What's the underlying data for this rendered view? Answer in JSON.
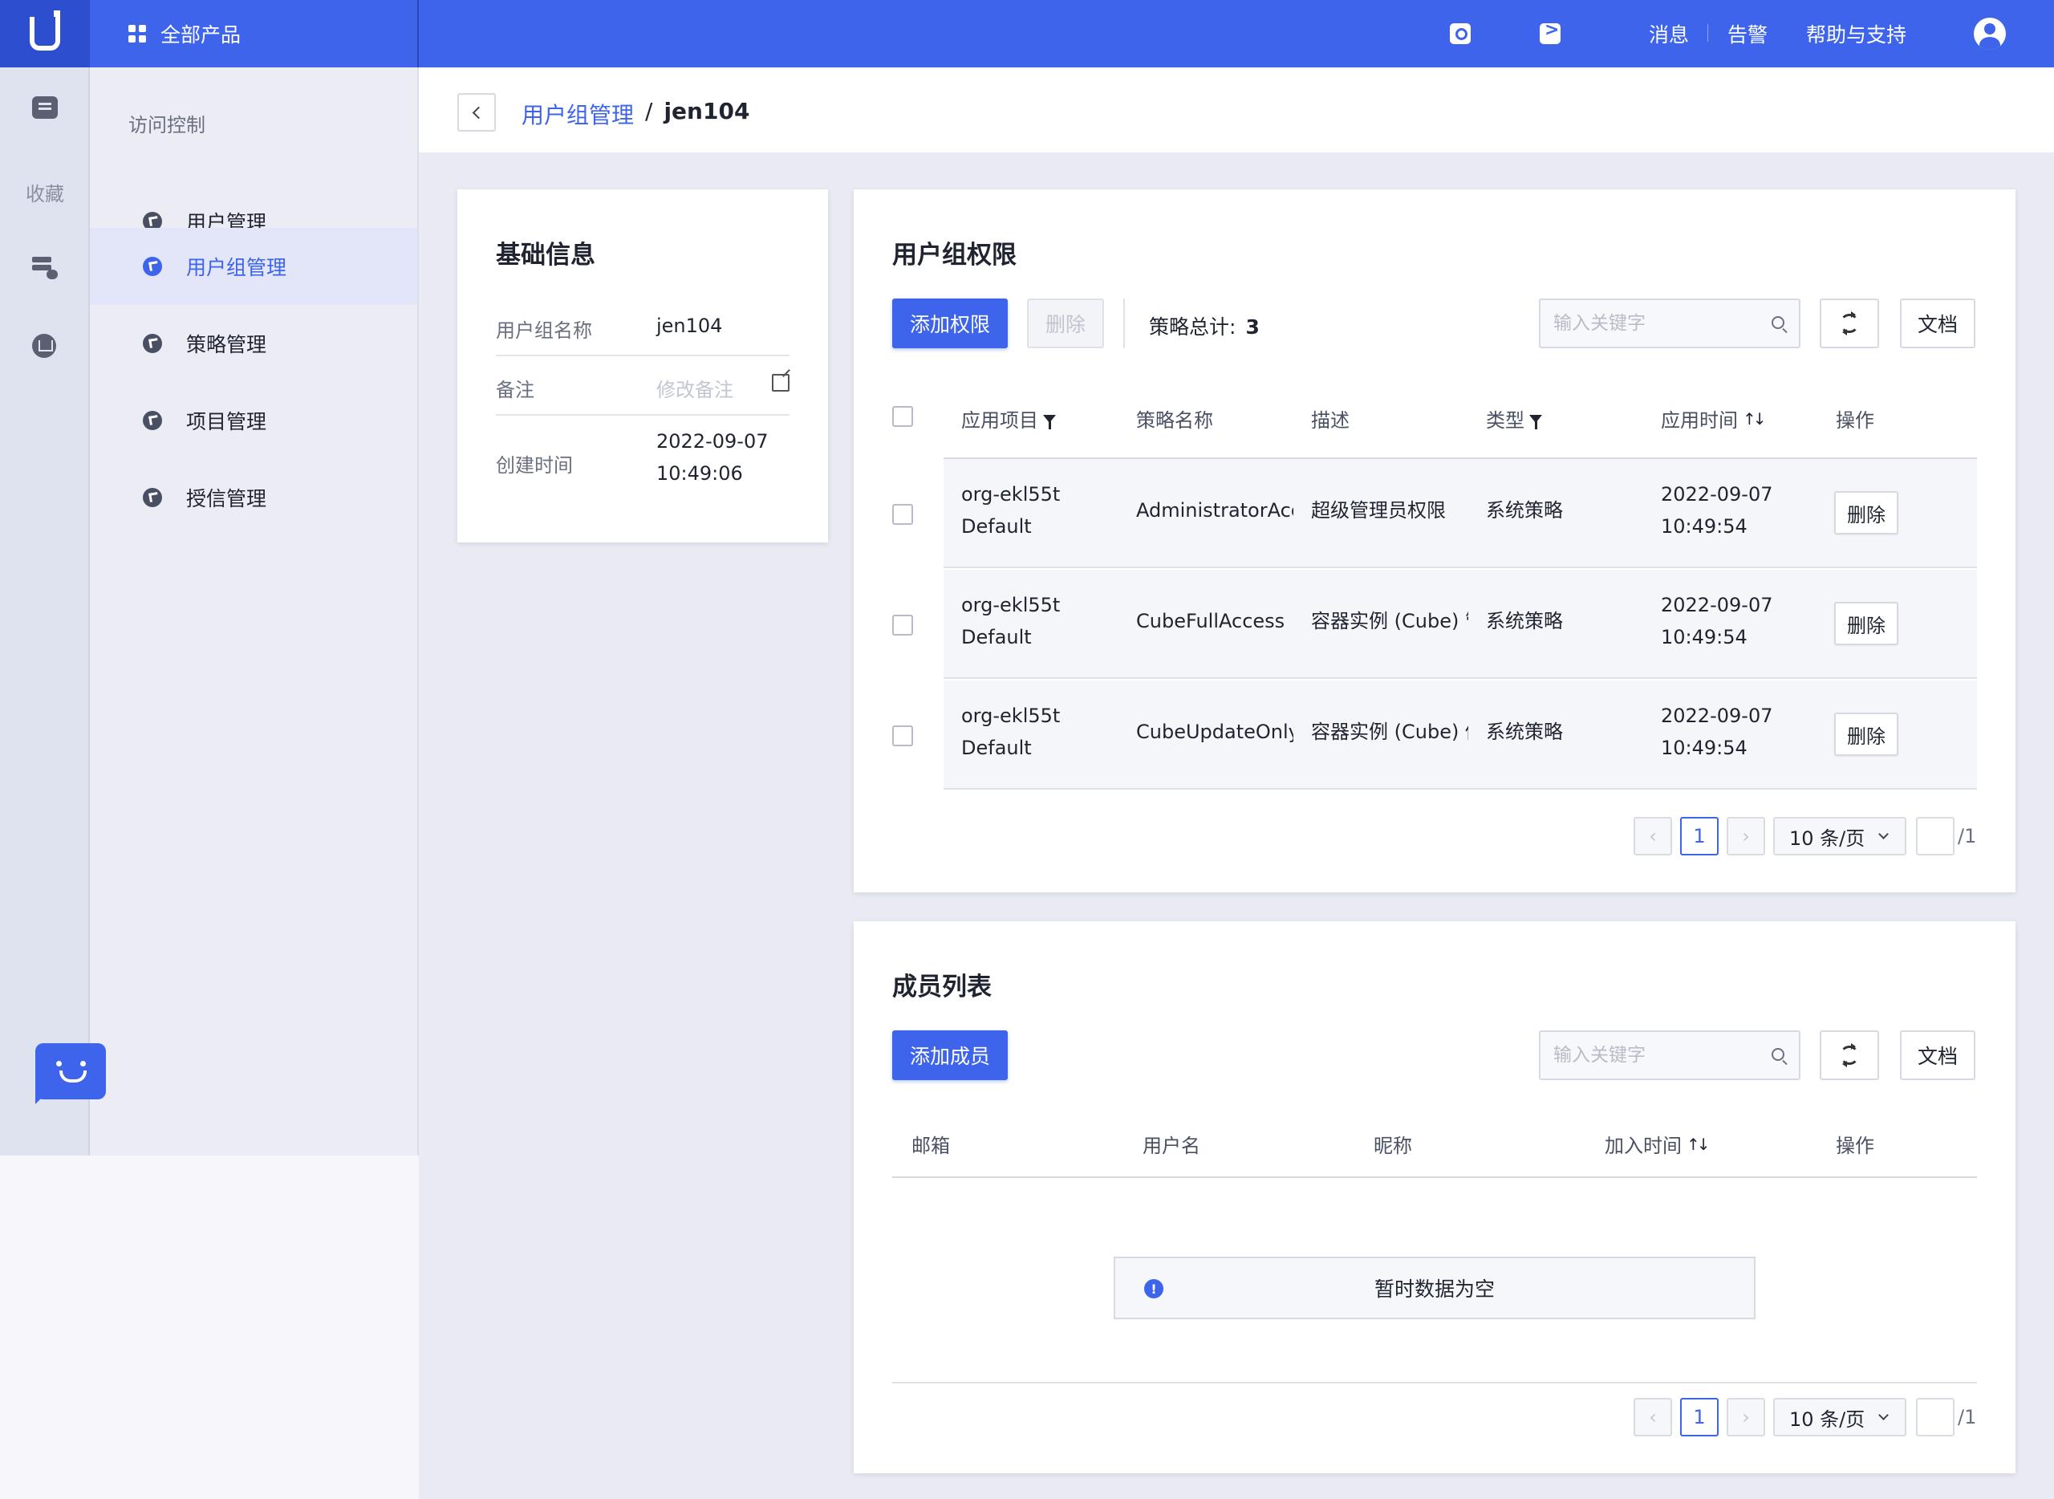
{
  "topbar": {
    "all_products": "全部产品",
    "messages": "消息",
    "alerts": "告警",
    "help": "帮助与支持",
    "brand_color": "#3d64ea"
  },
  "rail": {
    "favorites": "收藏"
  },
  "subnav": {
    "title": "访问控制",
    "items": [
      {
        "label": "用户管理",
        "active": false
      },
      {
        "label": "用户组管理",
        "active": true
      },
      {
        "label": "策略管理",
        "active": false
      },
      {
        "label": "项目管理",
        "active": false
      },
      {
        "label": "授信管理",
        "active": false
      }
    ]
  },
  "breadcrumb": {
    "parent": "用户组管理",
    "sep": "/",
    "current": "jen104"
  },
  "info": {
    "title": "基础信息",
    "name_label": "用户组名称",
    "name_value": "jen104",
    "remark_label": "备注",
    "remark_placeholder": "修改备注",
    "created_label": "创建时间",
    "created_date": "2022-09-07",
    "created_time": "10:49:06"
  },
  "permissions": {
    "title": "用户组权限",
    "add_label": "添加权限",
    "delete_label": "删除",
    "total_label": "策略总计:",
    "total_value": "3",
    "search_placeholder": "输入关键字",
    "doc_label": "文档",
    "columns": [
      "应用项目",
      "策略名称",
      "描述",
      "类型",
      "应用时间",
      "操作"
    ],
    "rows": [
      {
        "project": "org-ekl55t",
        "project_sub": "Default",
        "policy": "AdministratorAccess",
        "desc": "超级管理员权限",
        "type": "系统策略",
        "date": "2022-09-07",
        "time": "10:49:54",
        "action": "删除"
      },
      {
        "project": "org-ekl55t",
        "project_sub": "Default",
        "policy": "CubeFullAccess",
        "desc": "容器实例 (Cube) 管理权限",
        "type": "系统策略",
        "date": "2022-09-07",
        "time": "10:49:54",
        "action": "删除"
      },
      {
        "project": "org-ekl55t",
        "project_sub": "Default",
        "policy": "CubeUpdateOnlyAccess",
        "desc": "容器实例 (Cube) 修改权限",
        "type": "系统策略",
        "date": "2022-09-07",
        "time": "10:49:54",
        "action": "删除"
      }
    ],
    "pager": {
      "page": "1",
      "size": "10 条/页",
      "total": "/1"
    }
  },
  "members": {
    "title": "成员列表",
    "add_label": "添加成员",
    "search_placeholder": "输入关键字",
    "doc_label": "文档",
    "columns": [
      "邮箱",
      "用户名",
      "昵称",
      "加入时间",
      "操作"
    ],
    "empty_text": "暂时数据为空",
    "pager": {
      "page": "1",
      "size": "10 条/页",
      "total": "/1"
    }
  }
}
